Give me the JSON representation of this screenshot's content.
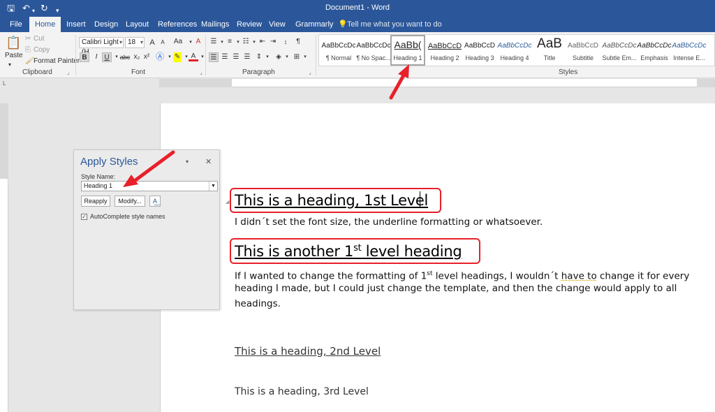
{
  "title_bar": {
    "title": "Document1 - Word"
  },
  "tabs": [
    "File",
    "Home",
    "Insert",
    "Design",
    "Layout",
    "References",
    "Mailings",
    "Review",
    "View",
    "Grammarly"
  ],
  "tell_me": "Tell me what you want to do",
  "clipboard": {
    "paste": "Paste",
    "cut": "Cut",
    "copy": "Copy",
    "format_painter": "Format Painter",
    "label": "Clipboard"
  },
  "font": {
    "name": "Calibri Light (H",
    "size": "18",
    "label": "Font",
    "bold": "B",
    "italic": "I",
    "underline": "U",
    "strike": "abc",
    "sub": "x₂",
    "sup": "x²",
    "change_case": "Aa",
    "grow": "A",
    "shrink": "A",
    "clear": "A"
  },
  "paragraph": {
    "label": "Paragraph"
  },
  "styles": {
    "label": "Styles",
    "items": [
      {
        "preview": "AaBbCcDc",
        "name": "¶ Normal"
      },
      {
        "preview": "AaBbCcDc",
        "name": "¶ No Spac..."
      },
      {
        "preview": "AaBb(",
        "name": "Heading 1"
      },
      {
        "preview": "AaBbCcD",
        "name": "Heading 2"
      },
      {
        "preview": "AaBbCcD",
        "name": "Heading 3"
      },
      {
        "preview": "AaBbCcDc",
        "name": "Heading 4"
      },
      {
        "preview": "AaB",
        "name": "Title"
      },
      {
        "preview": "AaBbCcD",
        "name": "Subtitle"
      },
      {
        "preview": "AaBbCcDc",
        "name": "Subtle Em..."
      },
      {
        "preview": "AaBbCcDc",
        "name": "Emphasis"
      },
      {
        "preview": "AaBbCcDc",
        "name": "Intense E..."
      }
    ],
    "selected_index": 2
  },
  "apply_styles": {
    "title": "Apply Styles",
    "style_name_label": "Style Name:",
    "style_name_value": "Heading 1",
    "reapply": "Reapply",
    "modify": "Modify...",
    "autocomplete": "AutoComplete style names",
    "autocomplete_checked": true
  },
  "document": {
    "h1_a": "This is a heading, 1st Level",
    "body_1": "I didn´t set the font size, the underline formatting or whatsoever.",
    "h1_b_pre": "This is another 1",
    "h1_b_sup": "st",
    "h1_b_post": " level heading",
    "body_2_l1_pre": "If I wanted to change the formatting of 1",
    "body_2_l1_sup": "st",
    "body_2_l1_mid": " level headings, I wouldn´t ",
    "body_2_l1_spell": "have to",
    "body_2_l1_post": " change it for every",
    "body_2_l2": "heading I made, but I could just change the template, and then the change would apply to all",
    "body_2_l3": "headings.",
    "h2": "This is a heading, 2nd Level",
    "h3": "This is a heading, 3rd Level"
  },
  "colors": {
    "word_blue": "#2b579a",
    "highlight_red": "#e8202a"
  }
}
